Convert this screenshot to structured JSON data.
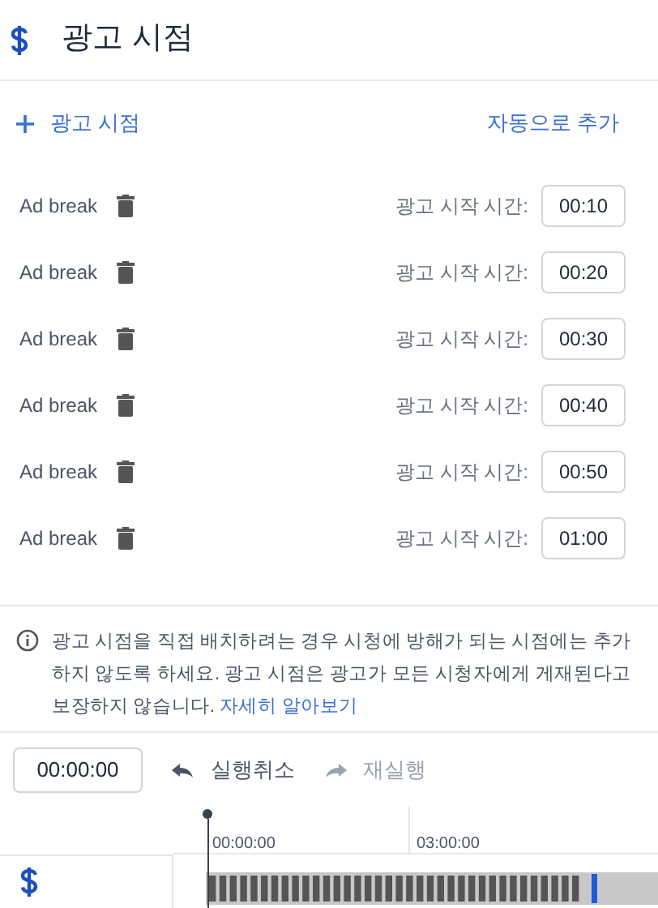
{
  "header": {
    "title": "광고 시점"
  },
  "actions": {
    "add": "광고 시점",
    "auto": "자동으로 추가"
  },
  "breaks": [
    {
      "label": "Ad break",
      "time_label": "광고 시작 시간:",
      "time": "00:10"
    },
    {
      "label": "Ad break",
      "time_label": "광고 시작 시간:",
      "time": "00:20"
    },
    {
      "label": "Ad break",
      "time_label": "광고 시작 시간:",
      "time": "00:30"
    },
    {
      "label": "Ad break",
      "time_label": "광고 시작 시간:",
      "time": "00:40"
    },
    {
      "label": "Ad break",
      "time_label": "광고 시작 시간:",
      "time": "00:50"
    },
    {
      "label": "Ad break",
      "time_label": "광고 시작 시간:",
      "time": "01:00"
    }
  ],
  "notice": {
    "text": "광고 시점을 직접 배치하려는 경우 시청에 방해가 되는 시점에는 추가하지 않도록 하세요. 광고 시점은 광고가 모든 시청자에게 게재된다고 보장하지 않습니다.",
    "link": "자세히 알아보기"
  },
  "toolbar": {
    "timecode": "00:00:00",
    "undo": {
      "label": "실행취소",
      "disabled": false
    },
    "redo": {
      "label": "재실행",
      "disabled": true
    }
  },
  "timeline": {
    "ticks": [
      "00:00:00",
      "03:00:00"
    ]
  }
}
